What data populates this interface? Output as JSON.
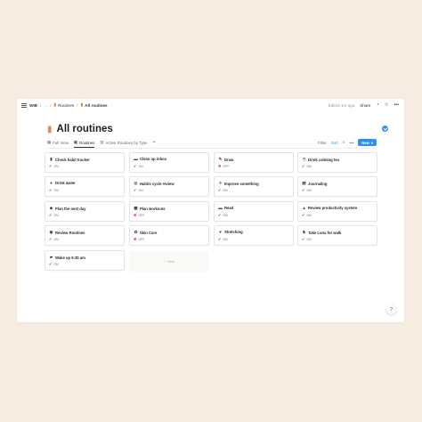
{
  "topbar": {
    "workspace": "WIB",
    "ellipsis": "...",
    "parent": "Routines",
    "current": "All routines",
    "edited": "Edited 1m ago",
    "share": "Share"
  },
  "page": {
    "title": "All routines"
  },
  "tabs": [
    {
      "label": "Full View"
    },
    {
      "label": "Routines"
    },
    {
      "label": "Active Routines by Type"
    }
  ],
  "toolbar": {
    "filter": "Filter",
    "sort": "Sort",
    "new": "New"
  },
  "cards": [
    {
      "icon": "pill-icon",
      "glyph": "▮",
      "title": "Check habit tracker",
      "status": "ON",
      "on": true
    },
    {
      "icon": "inbox-icon",
      "glyph": "▬",
      "title": "Clean up inbox",
      "status": "ON",
      "on": true
    },
    {
      "icon": "pencil-icon",
      "glyph": "✎",
      "title": "Draw",
      "status": "OFF",
      "on": false
    },
    {
      "icon": "coffee-icon",
      "glyph": "☕",
      "title": "Drink calming tea",
      "status": "ON",
      "on": true
    },
    {
      "icon": "drop-icon",
      "glyph": "●",
      "title": "Drink water",
      "status": "ON",
      "on": true
    },
    {
      "icon": "cycle-icon",
      "glyph": "◎",
      "title": "Habits cycle review",
      "status": "ON",
      "on": true
    },
    {
      "icon": "wand-icon",
      "glyph": "✧",
      "title": "Improve something",
      "status": "ON",
      "on": true
    },
    {
      "icon": "journal-icon",
      "glyph": "▤",
      "title": "Journaling",
      "status": "ON",
      "on": true
    },
    {
      "icon": "pin-icon",
      "glyph": "◆",
      "title": "Plan the next day",
      "status": "ON",
      "on": true
    },
    {
      "icon": "plan-icon",
      "glyph": "▦",
      "title": "Plan workouts",
      "status": "OFF",
      "on": false
    },
    {
      "icon": "book-icon",
      "glyph": "▬",
      "title": "Read",
      "status": "ON",
      "on": true
    },
    {
      "icon": "flask-icon",
      "glyph": "▲",
      "title": "Review productivity system",
      "status": "ON",
      "on": true
    },
    {
      "icon": "check-circle-icon",
      "glyph": "◉",
      "title": "Review Routines",
      "status": "ON",
      "on": true
    },
    {
      "icon": "skin-icon",
      "glyph": "✿",
      "title": "Skin Care",
      "status": "OFF",
      "on": false
    },
    {
      "icon": "heart-icon",
      "glyph": "♥",
      "title": "Stretching",
      "status": "ON",
      "on": true
    },
    {
      "icon": "dog-icon",
      "glyph": "♞",
      "title": "Take Luna for walk",
      "status": "ON",
      "on": true
    },
    {
      "icon": "bed-icon",
      "glyph": "▰",
      "title": "Wake up 6:30 am",
      "status": "ON",
      "on": true
    }
  ],
  "new_card": {
    "label": "New"
  },
  "help": {
    "label": "?"
  },
  "colors": {
    "accent": "#2e8ff0",
    "background": "#f7ece1",
    "on": "#2f9e44",
    "off": "#d44c47"
  }
}
